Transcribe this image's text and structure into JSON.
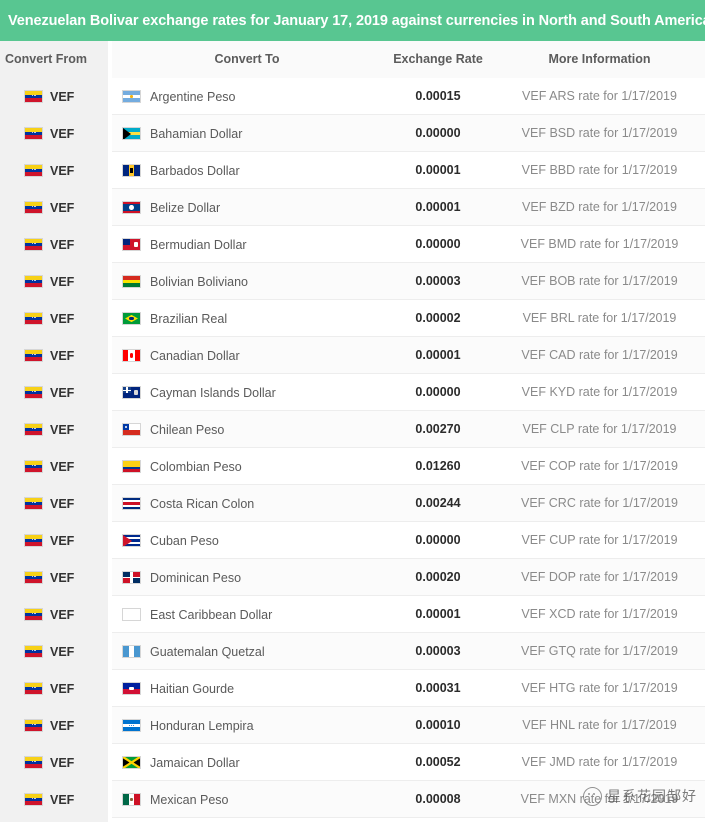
{
  "title": "Venezuelan Bolivar exchange rates for January 17, 2019 against currencies in North and South America",
  "colors": {
    "header_green": "#58c691",
    "rail_gray": "#f1f1f1",
    "rate_text": "#2b2b2b",
    "info_text": "#8a8a8a"
  },
  "table": {
    "columns": {
      "convert_from": "Convert From",
      "convert_to": "Convert To",
      "exchange_rate": "Exchange Rate",
      "more_information": "More Information"
    },
    "base_currency_code": "VEF",
    "base_flag_icon": "venezuela-flag-icon",
    "rows": [
      {
        "from_code": "VEF",
        "from_flag": "venezuela-flag-icon",
        "to_flag": "argentina-flag-icon",
        "to_name": "Argentine Peso",
        "rate": "0.00015",
        "info": "VEF ARS rate for 1/17/2019"
      },
      {
        "from_code": "VEF",
        "from_flag": "venezuela-flag-icon",
        "to_flag": "bahamas-flag-icon",
        "to_name": "Bahamian Dollar",
        "rate": "0.00000",
        "info": "VEF BSD rate for 1/17/2019"
      },
      {
        "from_code": "VEF",
        "from_flag": "venezuela-flag-icon",
        "to_flag": "barbados-flag-icon",
        "to_name": "Barbados Dollar",
        "rate": "0.00001",
        "info": "VEF BBD rate for 1/17/2019"
      },
      {
        "from_code": "VEF",
        "from_flag": "venezuela-flag-icon",
        "to_flag": "belize-flag-icon",
        "to_name": "Belize Dollar",
        "rate": "0.00001",
        "info": "VEF BZD rate for 1/17/2019"
      },
      {
        "from_code": "VEF",
        "from_flag": "venezuela-flag-icon",
        "to_flag": "bermuda-flag-icon",
        "to_name": "Bermudian Dollar",
        "rate": "0.00000",
        "info": "VEF BMD rate for 1/17/2019"
      },
      {
        "from_code": "VEF",
        "from_flag": "venezuela-flag-icon",
        "to_flag": "bolivia-flag-icon",
        "to_name": "Bolivian Boliviano",
        "rate": "0.00003",
        "info": "VEF BOB rate for 1/17/2019"
      },
      {
        "from_code": "VEF",
        "from_flag": "venezuela-flag-icon",
        "to_flag": "brazil-flag-icon",
        "to_name": "Brazilian Real",
        "rate": "0.00002",
        "info": "VEF BRL rate for 1/17/2019"
      },
      {
        "from_code": "VEF",
        "from_flag": "venezuela-flag-icon",
        "to_flag": "canada-flag-icon",
        "to_name": "Canadian Dollar",
        "rate": "0.00001",
        "info": "VEF CAD rate for 1/17/2019"
      },
      {
        "from_code": "VEF",
        "from_flag": "venezuela-flag-icon",
        "to_flag": "cayman-islands-flag-icon",
        "to_name": "Cayman Islands Dollar",
        "rate": "0.00000",
        "info": "VEF KYD rate for 1/17/2019"
      },
      {
        "from_code": "VEF",
        "from_flag": "venezuela-flag-icon",
        "to_flag": "chile-flag-icon",
        "to_name": "Chilean Peso",
        "rate": "0.00270",
        "info": "VEF CLP rate for 1/17/2019"
      },
      {
        "from_code": "VEF",
        "from_flag": "venezuela-flag-icon",
        "to_flag": "colombia-flag-icon",
        "to_name": "Colombian Peso",
        "rate": "0.01260",
        "info": "VEF COP rate for 1/17/2019"
      },
      {
        "from_code": "VEF",
        "from_flag": "venezuela-flag-icon",
        "to_flag": "costa-rica-flag-icon",
        "to_name": "Costa Rican Colon",
        "rate": "0.00244",
        "info": "VEF CRC rate for 1/17/2019"
      },
      {
        "from_code": "VEF",
        "from_flag": "venezuela-flag-icon",
        "to_flag": "cuba-flag-icon",
        "to_name": "Cuban Peso",
        "rate": "0.00000",
        "info": "VEF CUP rate for 1/17/2019"
      },
      {
        "from_code": "VEF",
        "from_flag": "venezuela-flag-icon",
        "to_flag": "dominican-republic-flag-icon",
        "to_name": "Dominican Peso",
        "rate": "0.00020",
        "info": "VEF DOP rate for 1/17/2019"
      },
      {
        "from_code": "VEF",
        "from_flag": "venezuela-flag-icon",
        "to_flag": "blank-flag-icon",
        "to_name": "East Caribbean Dollar",
        "rate": "0.00001",
        "info": "VEF XCD rate for 1/17/2019"
      },
      {
        "from_code": "VEF",
        "from_flag": "venezuela-flag-icon",
        "to_flag": "guatemala-flag-icon",
        "to_name": "Guatemalan Quetzal",
        "rate": "0.00003",
        "info": "VEF GTQ rate for 1/17/2019"
      },
      {
        "from_code": "VEF",
        "from_flag": "venezuela-flag-icon",
        "to_flag": "haiti-flag-icon",
        "to_name": "Haitian Gourde",
        "rate": "0.00031",
        "info": "VEF HTG rate for 1/17/2019"
      },
      {
        "from_code": "VEF",
        "from_flag": "venezuela-flag-icon",
        "to_flag": "honduras-flag-icon",
        "to_name": "Honduran Lempira",
        "rate": "0.00010",
        "info": "VEF HNL rate for 1/17/2019"
      },
      {
        "from_code": "VEF",
        "from_flag": "venezuela-flag-icon",
        "to_flag": "jamaica-flag-icon",
        "to_name": "Jamaican Dollar",
        "rate": "0.00052",
        "info": "VEF JMD rate for 1/17/2019"
      },
      {
        "from_code": "VEF",
        "from_flag": "venezuela-flag-icon",
        "to_flag": "mexico-flag-icon",
        "to_name": "Mexican Peso",
        "rate": "0.00008",
        "info": "VEF MXN rate for 1/17/2019"
      }
    ]
  },
  "watermark": {
    "icon": "cat-face-icon",
    "text": "星系花园郜好"
  }
}
